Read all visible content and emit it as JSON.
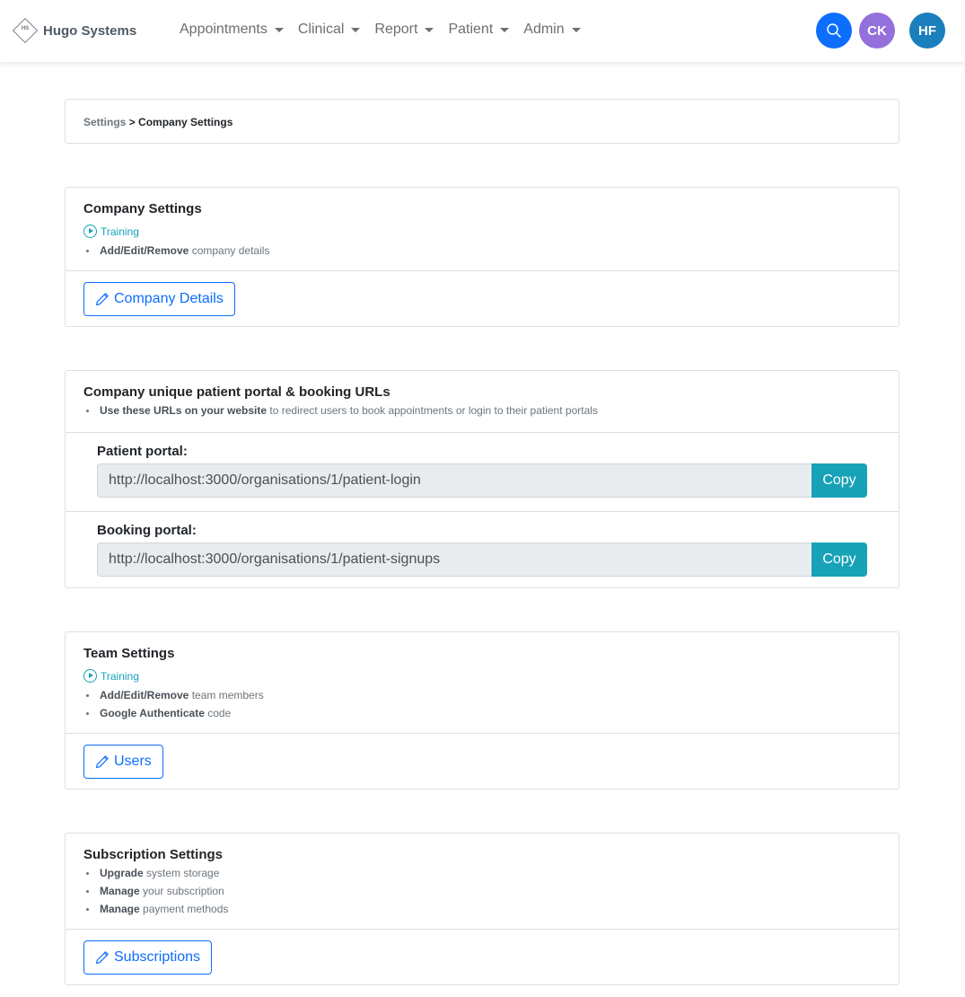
{
  "navbar": {
    "brand_logo_text": "HS",
    "brand_name": "Hugo Systems",
    "menu": [
      {
        "label": "Appointments"
      },
      {
        "label": "Clinical"
      },
      {
        "label": "Report"
      },
      {
        "label": "Patient"
      },
      {
        "label": "Admin"
      }
    ],
    "search_icon": "search-icon",
    "user_avatars": [
      {
        "initials": "CK",
        "color": "#9370db"
      },
      {
        "initials": "HF",
        "color": "#1a7fbc"
      }
    ]
  },
  "breadcrumb": {
    "parent": "Settings",
    "separator": ">",
    "current": "Company Settings"
  },
  "company_settings": {
    "title": "Company Settings",
    "training_label": "Training",
    "bullets": [
      {
        "bold": "Add/Edit/Remove",
        "text": " company details"
      }
    ],
    "button_label": "Company Details"
  },
  "urls": {
    "title": "Company unique patient portal & booking URLs",
    "bullets": [
      {
        "bold": "Use these URLs on your website",
        "text": " to redirect users to book appointments or login to their patient portals"
      }
    ],
    "patient_portal": {
      "label": "Patient portal:",
      "value": "http://localhost:3000/organisations/1/patient-login",
      "copy_label": "Copy"
    },
    "booking_portal": {
      "label": "Booking portal:",
      "value": "http://localhost:3000/organisations/1/patient-signups",
      "copy_label": "Copy"
    }
  },
  "team_settings": {
    "title": "Team Settings",
    "training_label": "Training",
    "bullets": [
      {
        "bold": "Add/Edit/Remove",
        "text": " team members"
      },
      {
        "bold": "Google Authenticate",
        "text": " code"
      }
    ],
    "button_label": "Users"
  },
  "subscription_settings": {
    "title": "Subscription Settings",
    "bullets": [
      {
        "bold": "Upgrade",
        "text": " system storage"
      },
      {
        "bold": "Manage",
        "text": " your subscription"
      },
      {
        "bold": "Manage",
        "text": " payment methods"
      }
    ],
    "button_label": "Subscriptions"
  },
  "colors": {
    "primary": "#0d6efd",
    "info": "#17a2b8",
    "muted": "#6c757d"
  }
}
